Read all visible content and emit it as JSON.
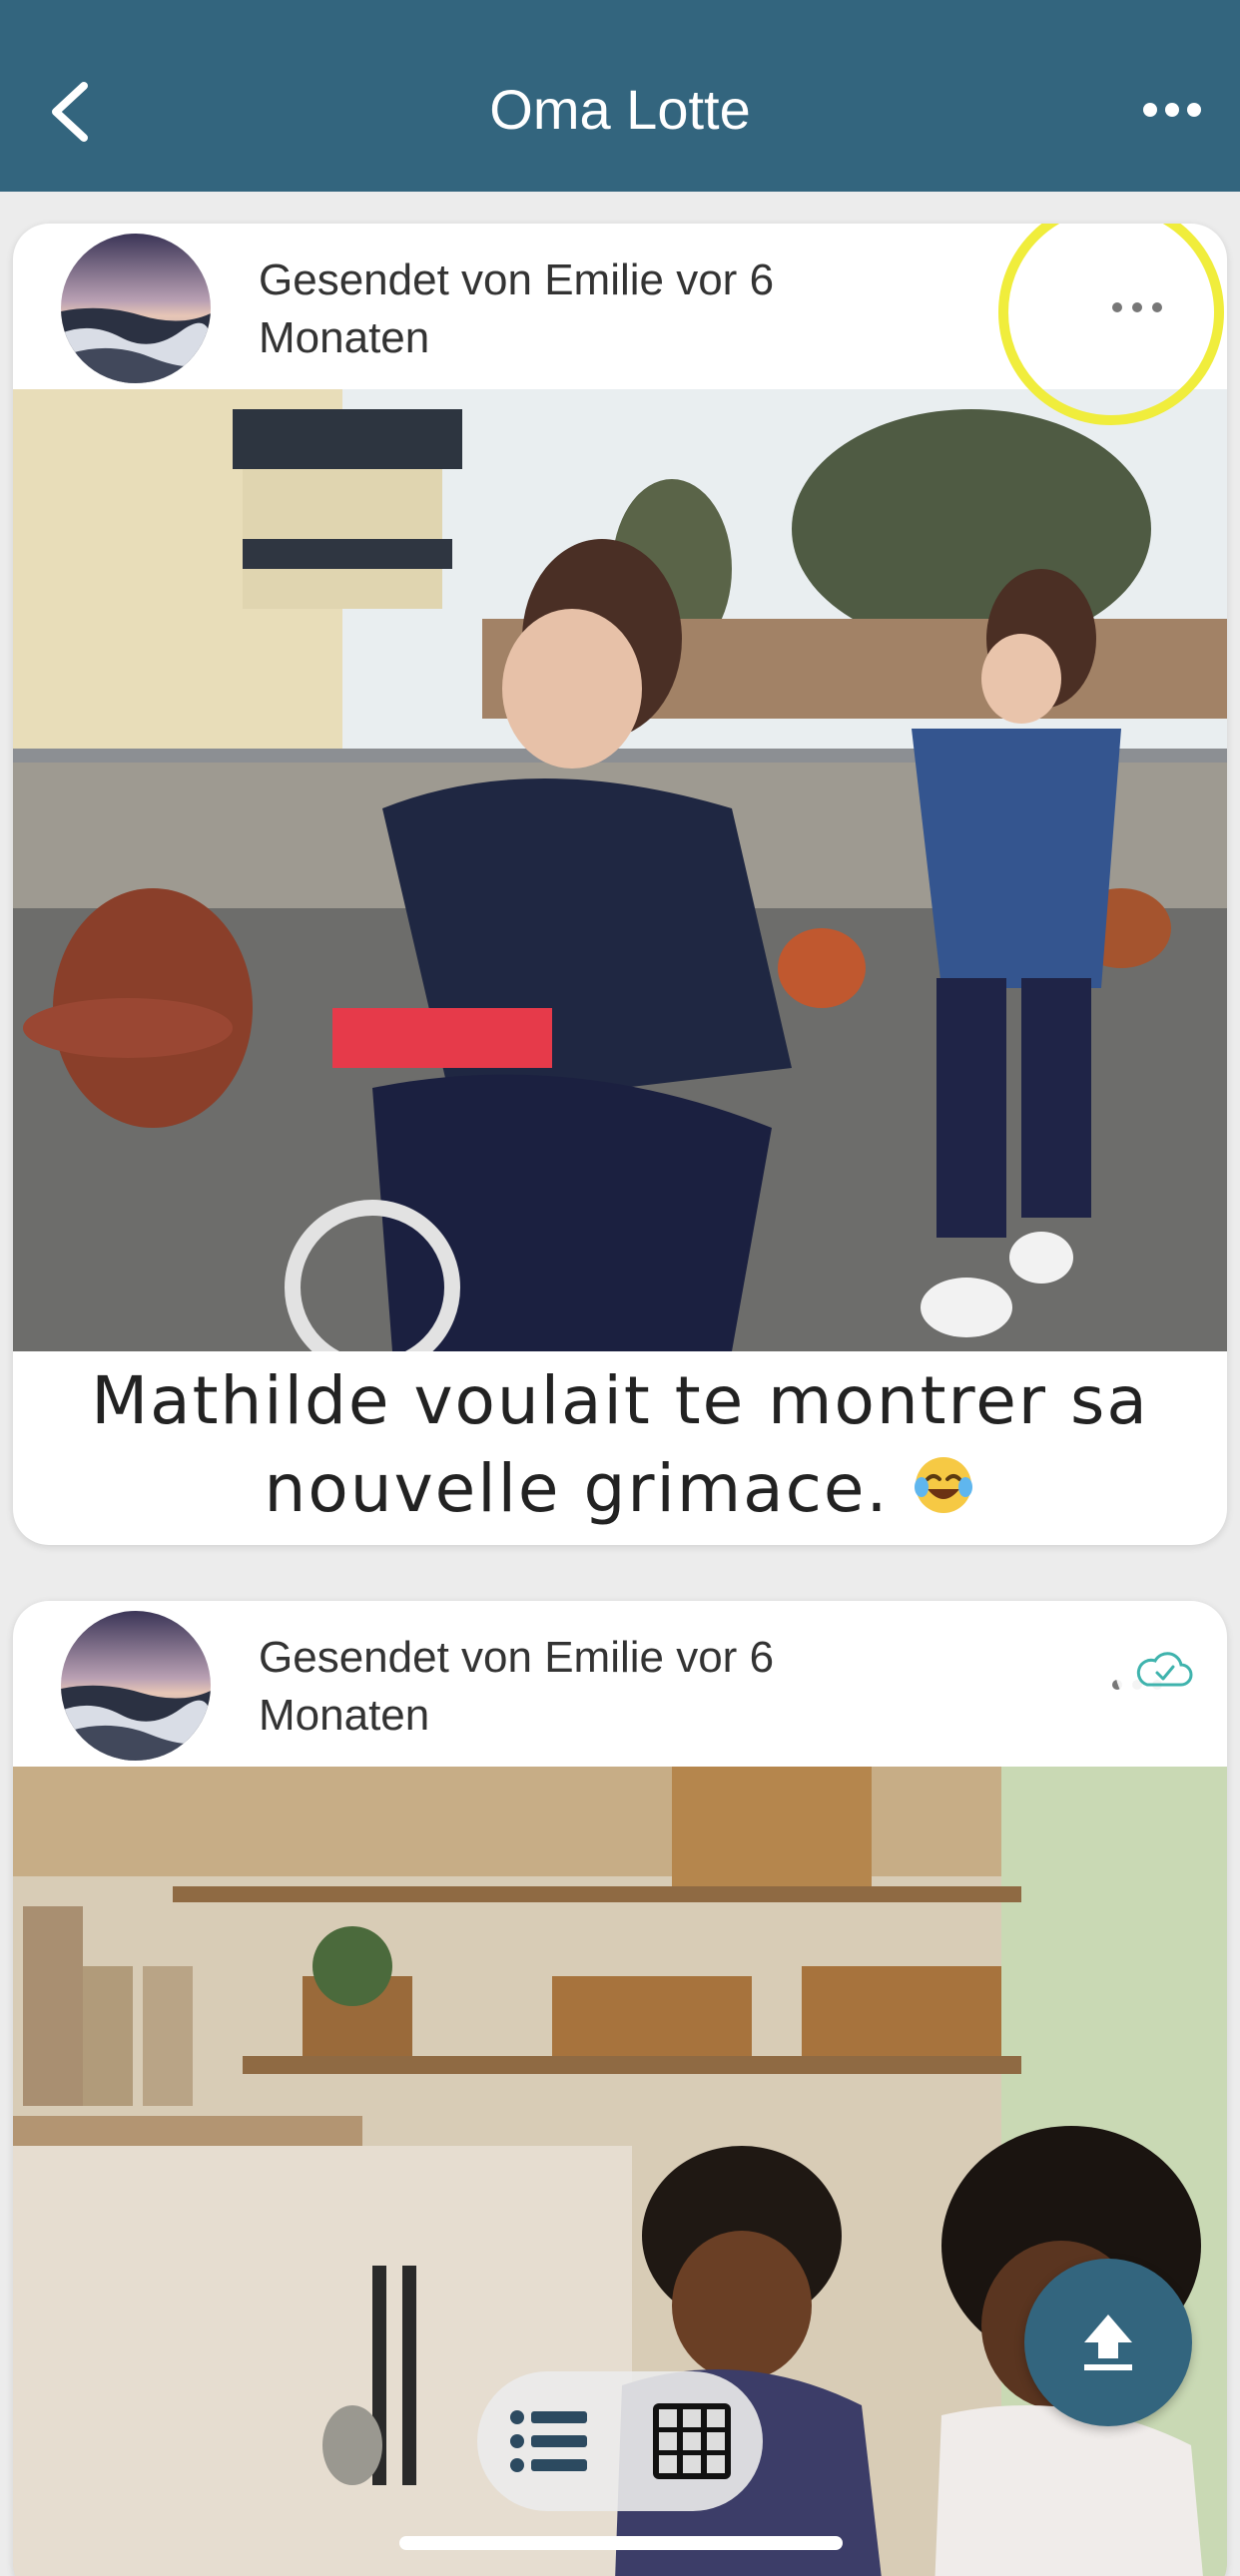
{
  "header": {
    "title": "Oma Lotte",
    "back_icon": "chevron-left-icon",
    "more_icon": "ellipsis-icon"
  },
  "posts": [
    {
      "sender": "Gesendet von Emilie vor 6 Monaten",
      "caption": "Mathilde voulait te montrer sa nouvelle grimace.",
      "caption_emoji": "face-with-tears-of-joy",
      "photo": "girl-on-bike-with-sister"
    },
    {
      "sender": "Gesendet von Emilie vor 6 Monaten",
      "photo": "kids-in-kitchen",
      "status_icon": "cloud-synced-icon"
    }
  ],
  "fab": {
    "icon": "upload-icon"
  },
  "view_toggle": {
    "list_icon": "list-view-icon",
    "grid_icon": "grid-view-icon"
  },
  "colors": {
    "header": "#33657e",
    "highlight": "#f0ed3c",
    "background": "#ececec"
  }
}
